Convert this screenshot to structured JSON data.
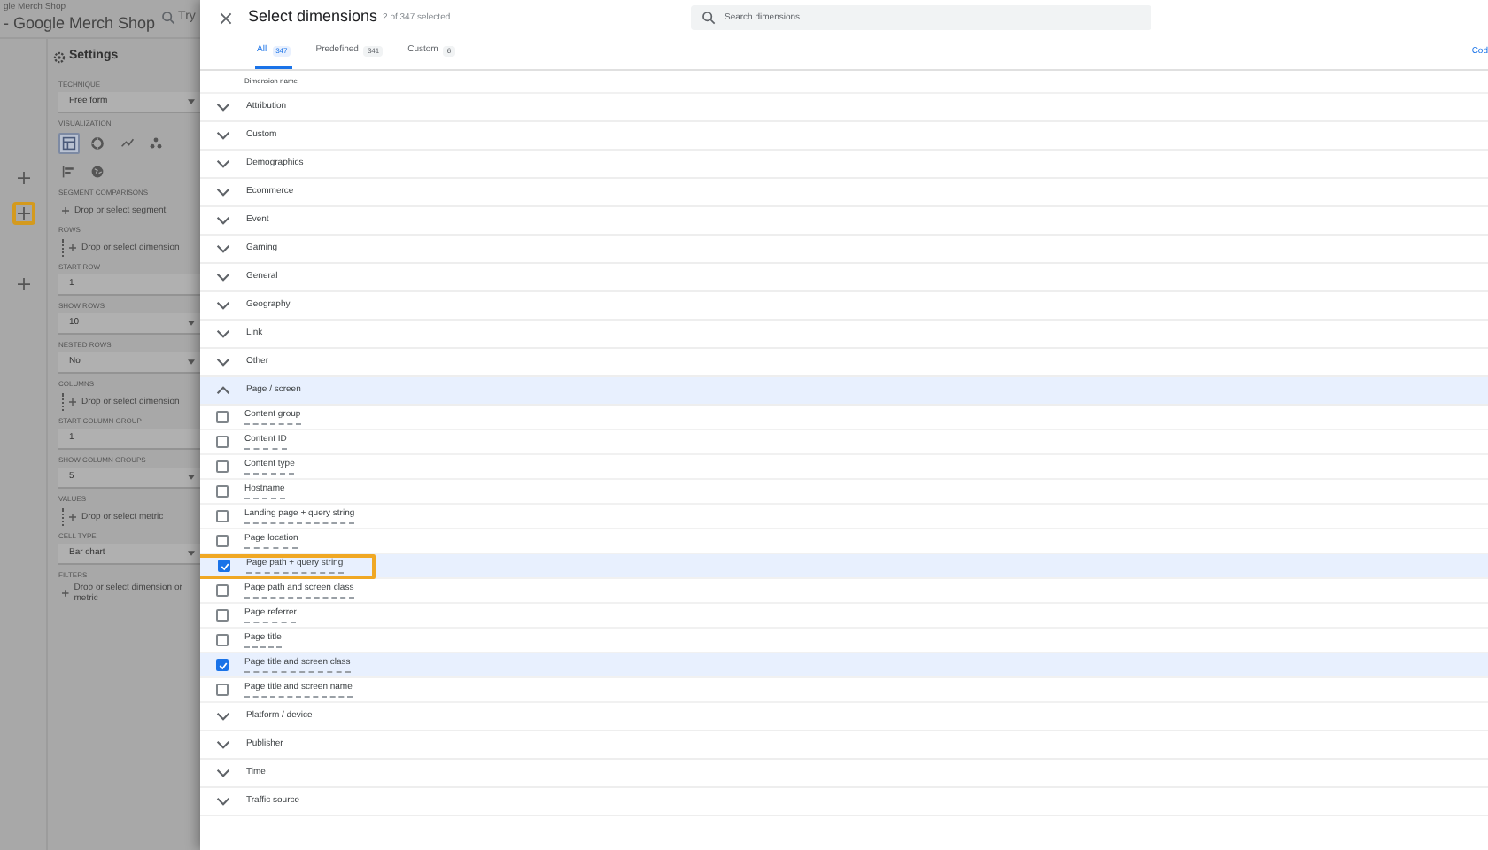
{
  "app": {
    "property_caption": "gle Merch Shop",
    "property_name": "- Google Merch Shop",
    "search_text": "Try"
  },
  "left_rail": [
    {
      "highlighted": false
    },
    {
      "highlighted": true
    },
    {
      "highlighted": false
    }
  ],
  "settings": {
    "title": "Settings",
    "sections": [
      {
        "label": "TECHNIQUE",
        "kind": "select",
        "value": "Free form"
      },
      {
        "label": "VISUALIZATION",
        "kind": "icons",
        "icons": [
          {
            "kind": "table",
            "selected": true
          },
          {
            "kind": "donut",
            "selected": false
          },
          {
            "kind": "line",
            "selected": false
          },
          {
            "kind": "scatter",
            "selected": false
          },
          {
            "kind": "bar",
            "selected": false
          },
          {
            "kind": "globe",
            "selected": false
          }
        ]
      },
      {
        "label": "SEGMENT COMPARISONS",
        "kind": "add",
        "value": "Drop or select segment"
      },
      {
        "label": "ROWS",
        "kind": "drop",
        "value": "Drop or select dimension"
      },
      {
        "label": "START ROW",
        "kind": "text",
        "value": "1"
      },
      {
        "label": "SHOW ROWS",
        "kind": "select",
        "value": "10"
      },
      {
        "label": "NESTED ROWS",
        "kind": "select",
        "value": "No"
      },
      {
        "label": "COLUMNS",
        "kind": "drop",
        "value": "Drop or select dimension"
      },
      {
        "label": "START COLUMN GROUP",
        "kind": "text",
        "value": "1"
      },
      {
        "label": "SHOW COLUMN GROUPS",
        "kind": "select",
        "value": "5"
      },
      {
        "label": "VALUES",
        "kind": "drop",
        "value": "Drop or select metric"
      },
      {
        "label": "CELL TYPE",
        "kind": "select",
        "value": "Bar chart"
      },
      {
        "label": "FILTERS",
        "kind": "add",
        "value": "Drop or select dimension or metric"
      }
    ]
  },
  "dialog": {
    "title": "Select dimensions",
    "subtitle": "2 of 347 selected",
    "search": {
      "placeholder": "Search dimensions"
    },
    "tabs": [
      {
        "label": "All",
        "count": "347",
        "selected": true
      },
      {
        "label": "Predefined",
        "count": "341",
        "selected": false
      },
      {
        "label": "Custom",
        "count": "6",
        "selected": false
      }
    ],
    "link": "Cod",
    "column_header": "Dimension name",
    "groups": [
      {
        "label": "Attribution",
        "expanded": false
      },
      {
        "label": "Custom",
        "expanded": false
      },
      {
        "label": "Demographics",
        "expanded": false
      },
      {
        "label": "Ecommerce",
        "expanded": false
      },
      {
        "label": "Event",
        "expanded": false
      },
      {
        "label": "Gaming",
        "expanded": false
      },
      {
        "label": "General",
        "expanded": false
      },
      {
        "label": "Geography",
        "expanded": false
      },
      {
        "label": "Link",
        "expanded": false
      },
      {
        "label": "Other",
        "expanded": false
      },
      {
        "label": "Page / screen",
        "expanded": true,
        "children": [
          {
            "label": "Content group",
            "checked": false,
            "highlighted": false
          },
          {
            "label": "Content ID",
            "checked": false,
            "highlighted": false
          },
          {
            "label": "Content type",
            "checked": false,
            "highlighted": false
          },
          {
            "label": "Hostname",
            "checked": false,
            "highlighted": false
          },
          {
            "label": "Landing page + query string",
            "checked": false,
            "highlighted": false
          },
          {
            "label": "Page location",
            "checked": false,
            "highlighted": false
          },
          {
            "label": "Page path + query string",
            "checked": true,
            "highlighted": true
          },
          {
            "label": "Page path and screen class",
            "checked": false,
            "highlighted": false
          },
          {
            "label": "Page referrer",
            "checked": false,
            "highlighted": false
          },
          {
            "label": "Page title",
            "checked": false,
            "highlighted": false
          },
          {
            "label": "Page title and screen class",
            "checked": true,
            "highlighted": false
          },
          {
            "label": "Page title and screen name",
            "checked": false,
            "highlighted": false
          }
        ]
      },
      {
        "label": "Platform / device",
        "expanded": false
      },
      {
        "label": "Publisher",
        "expanded": false
      },
      {
        "label": "Time",
        "expanded": false
      },
      {
        "label": "Traffic source",
        "expanded": false
      }
    ]
  }
}
